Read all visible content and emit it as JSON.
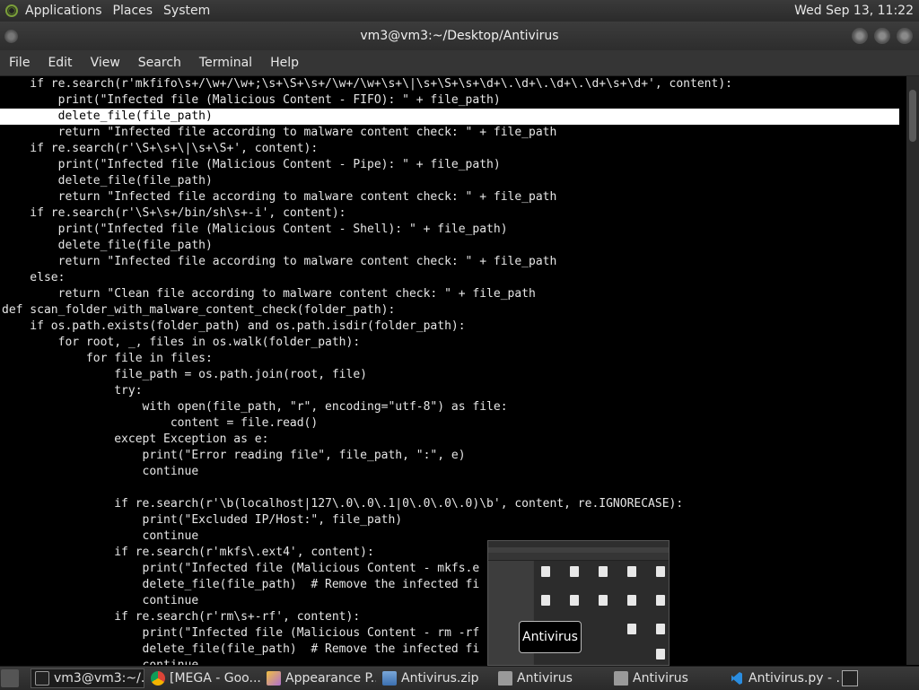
{
  "top_panel": {
    "applications": "Applications",
    "places": "Places",
    "system": "System",
    "clock": "Wed Sep 13, 11:22"
  },
  "window": {
    "title": "vm3@vm3:~/Desktop/Antivirus"
  },
  "menubar": [
    "File",
    "Edit",
    "View",
    "Search",
    "Terminal",
    "Help"
  ],
  "terminal": {
    "highlighted_line": 2,
    "lines": [
      "    if re.search(r'mkfifo\\s+/\\w+/\\w+;\\s+\\S+\\s+/\\w+/\\w+\\s+\\|\\s+\\S+\\s+\\d+\\.\\d+\\.\\d+\\.\\d+\\s+\\d+', content):",
      "        print(\"Infected file (Malicious Content - FIFO): \" + file_path)",
      "        delete_file(file_path)",
      "        return \"Infected file according to malware content check: \" + file_path",
      "    if re.search(r'\\S+\\s+\\|\\s+\\S+', content):",
      "        print(\"Infected file (Malicious Content - Pipe): \" + file_path)",
      "        delete_file(file_path)",
      "        return \"Infected file according to malware content check: \" + file_path",
      "    if re.search(r'\\S+\\s+/bin/sh\\s+-i', content):",
      "        print(\"Infected file (Malicious Content - Shell): \" + file_path)",
      "        delete_file(file_path)",
      "        return \"Infected file according to malware content check: \" + file_path",
      "    else:",
      "        return \"Clean file according to malware content check: \" + file_path",
      "def scan_folder_with_malware_content_check(folder_path):",
      "    if os.path.exists(folder_path) and os.path.isdir(folder_path):",
      "        for root, _, files in os.walk(folder_path):",
      "            for file in files:",
      "                file_path = os.path.join(root, file)",
      "                try:",
      "                    with open(file_path, \"r\", encoding=\"utf-8\") as file:",
      "                        content = file.read()",
      "                except Exception as e:",
      "                    print(\"Error reading file\", file_path, \":\", e)",
      "                    continue",
      "",
      "                if re.search(r'\\b(localhost|127\\.0\\.0\\.1|0\\.0\\.0\\.0)\\b', content, re.IGNORECASE):",
      "                    print(\"Excluded IP/Host:\", file_path)",
      "                    continue",
      "                if re.search(r'mkfs\\.ext4', content):",
      "                    print(\"Infected file (Malicious Content - mkfs.e",
      "                    delete_file(file_path)  # Remove the infected fi",
      "                    continue",
      "                if re.search(r'rm\\s+-rf', content):",
      "                    print(\"Infected file (Malicious Content - rm -rf",
      "                    delete_file(file_path)  # Remove the infected fi",
      "                    continue"
    ]
  },
  "tooltip": "Antivirus",
  "taskbar": {
    "items": [
      {
        "label": "vm3@vm3:~/...",
        "icon": "terminal-icon"
      },
      {
        "label": "[MEGA - Goo...",
        "icon": "chrome-icon"
      },
      {
        "label": "Appearance P...",
        "icon": "appearance-icon"
      },
      {
        "label": "Antivirus.zip",
        "icon": "archive-icon"
      },
      {
        "label": "Antivirus",
        "icon": "folder-icon"
      },
      {
        "label": "Antivirus",
        "icon": "folder-icon"
      },
      {
        "label": "Antivirus.py - ...",
        "icon": "vscode-icon"
      }
    ]
  }
}
